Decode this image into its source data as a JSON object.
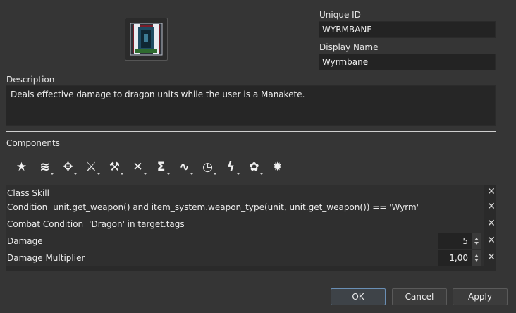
{
  "unique_id": {
    "label": "Unique ID",
    "value": "WYRMBANE"
  },
  "display_name": {
    "label": "Display Name",
    "value": "Wyrmbane"
  },
  "description": {
    "label": "Description",
    "value": "Deals effective damage to dragon units while the user is a Manakete."
  },
  "components": {
    "label": "Components",
    "toolbar": [
      {
        "icon": "star-icon",
        "glyph": "★"
      },
      {
        "icon": "layers-icon",
        "glyph": "≋"
      },
      {
        "icon": "move-icon",
        "glyph": "✥"
      },
      {
        "icon": "sword-icon",
        "glyph": "⚔"
      },
      {
        "icon": "axe-icon",
        "glyph": "⚒"
      },
      {
        "icon": "crossed-swords-icon",
        "glyph": "✕"
      },
      {
        "icon": "sigma-icon",
        "glyph": "Σ"
      },
      {
        "icon": "pulse-icon",
        "glyph": "∿"
      },
      {
        "icon": "clock-icon",
        "glyph": "◷"
      },
      {
        "icon": "lightning-icon",
        "glyph": "ϟ"
      },
      {
        "icon": "palette-icon",
        "glyph": "✿"
      },
      {
        "icon": "gear-icon",
        "glyph": "✹"
      }
    ],
    "rows": [
      {
        "name": "Class Skill",
        "value": ""
      },
      {
        "name": "Condition",
        "value": "unit.get_weapon() and item_system.weapon_type(unit, unit.get_weapon()) == 'Wyrm'"
      },
      {
        "name": "Combat Condition",
        "value": "'Dragon' in target.tags"
      },
      {
        "name": "Damage",
        "spin": "5"
      },
      {
        "name": "Damage Multiplier",
        "spin": "1,00"
      }
    ]
  },
  "buttons": {
    "ok": "OK",
    "cancel": "Cancel",
    "apply": "Apply"
  }
}
